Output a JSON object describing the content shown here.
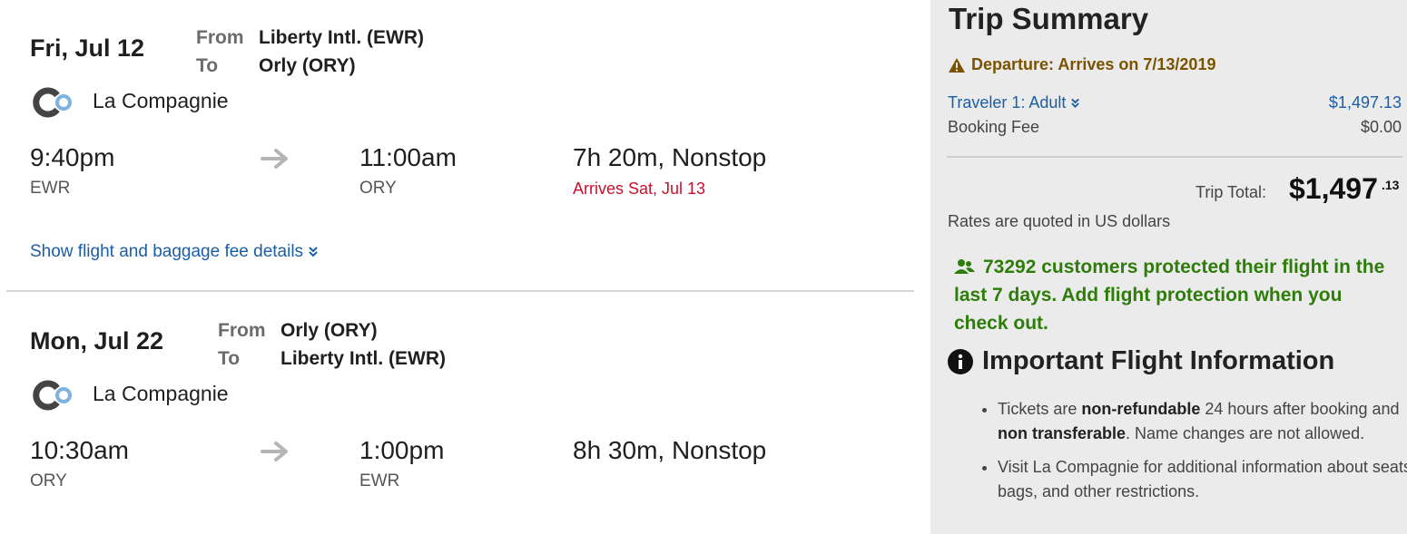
{
  "flights": [
    {
      "date": "Fri, Jul 12",
      "from_label": "From",
      "to_label": "To",
      "from": "Liberty Intl. (EWR)",
      "to": "Orly (ORY)",
      "airline": "La Compagnie",
      "depart_time": "9:40pm",
      "depart_code": "EWR",
      "arrive_time": "11:00am",
      "arrive_code": "ORY",
      "duration": "7h 20m, Nonstop",
      "arrives_note": "Arrives Sat, Jul 13",
      "details_link": "Show flight and baggage fee details"
    },
    {
      "date": "Mon, Jul 22",
      "from_label": "From",
      "to_label": "To",
      "from": "Orly (ORY)",
      "to": "Liberty Intl. (EWR)",
      "airline": "La Compagnie",
      "depart_time": "10:30am",
      "depart_code": "ORY",
      "arrive_time": "1:00pm",
      "arrive_code": "EWR",
      "duration": "8h 30m, Nonstop"
    }
  ],
  "summary": {
    "title": "Trip Summary",
    "warning": "Departure: Arrives on 7/13/2019",
    "traveler_label": "Traveler 1: Adult",
    "traveler_amount": "$1,497.13",
    "fee_label": "Booking Fee",
    "fee_amount": "$0.00",
    "total_label": "Trip Total:",
    "total_dollars": "$1,497",
    "total_cents": ".13",
    "rates_note": "Rates are quoted in US dollars",
    "protection": "73292 customers protected their flight in the last 7 days. Add flight protection when you check out."
  },
  "info": {
    "title": "Important Flight Information",
    "bullet1": {
      "p1": "Tickets are ",
      "b1": "non-refundable",
      "p2": " 24 hours after booking and ",
      "b2": "non transferable",
      "p3": ". Name changes are not allowed."
    },
    "bullet2": "Visit La Compagnie for additional information about seats, bags, and other restrictions."
  },
  "colors": {
    "link": "#1a5ea8",
    "alert_red": "#c8102e",
    "warning_brown": "#7a5300",
    "protect_green": "#2e7d0a",
    "panel_bg": "#ebebeb"
  },
  "icons": [
    "la-compagnie-logo-icon",
    "arrow-right-icon",
    "double-chevron-down-icon",
    "warning-triangle-icon",
    "users-icon",
    "info-circle-icon"
  ]
}
